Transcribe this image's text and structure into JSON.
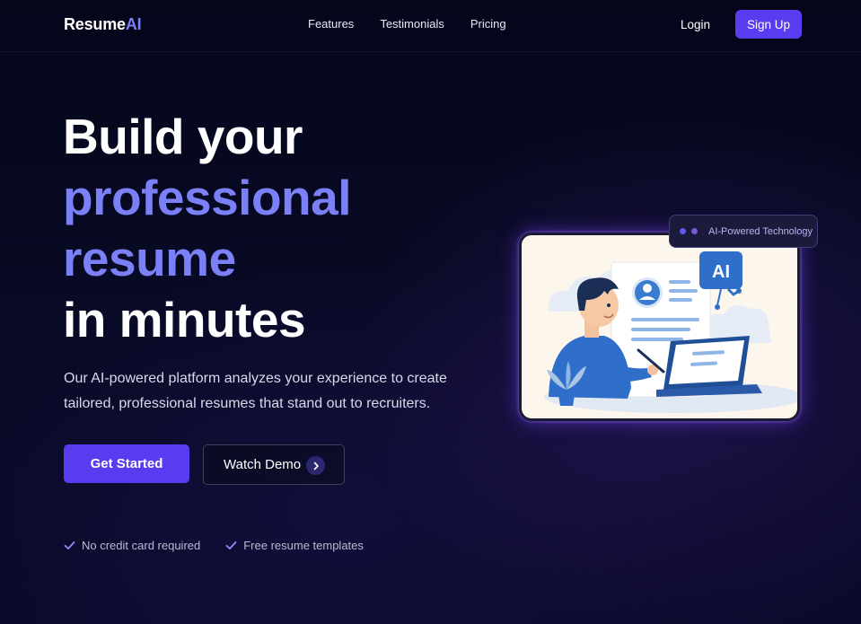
{
  "nav": {
    "logo_main": "Resume",
    "logo_accent": "AI",
    "links": [
      "Features",
      "Testimonials",
      "Pricing"
    ],
    "login": "Login",
    "signup": "Sign Up"
  },
  "hero": {
    "line1": "Build your",
    "line2": "professional",
    "line3": "resume",
    "line4": "in minutes",
    "subtext": "Our AI-powered platform analyzes your experience to create tailored, professional resumes that stand out to recruiters.",
    "cta_primary": "Get Started",
    "cta_secondary": "Watch Demo",
    "features": [
      "No credit card required",
      "Free resume templates"
    ]
  },
  "illustration": {
    "badge": "AI-Powered Technology",
    "ai_bubble": "AI"
  },
  "colors": {
    "accent": "#7c80f7",
    "brand": "#5a3cf0",
    "background": "#05061a"
  }
}
